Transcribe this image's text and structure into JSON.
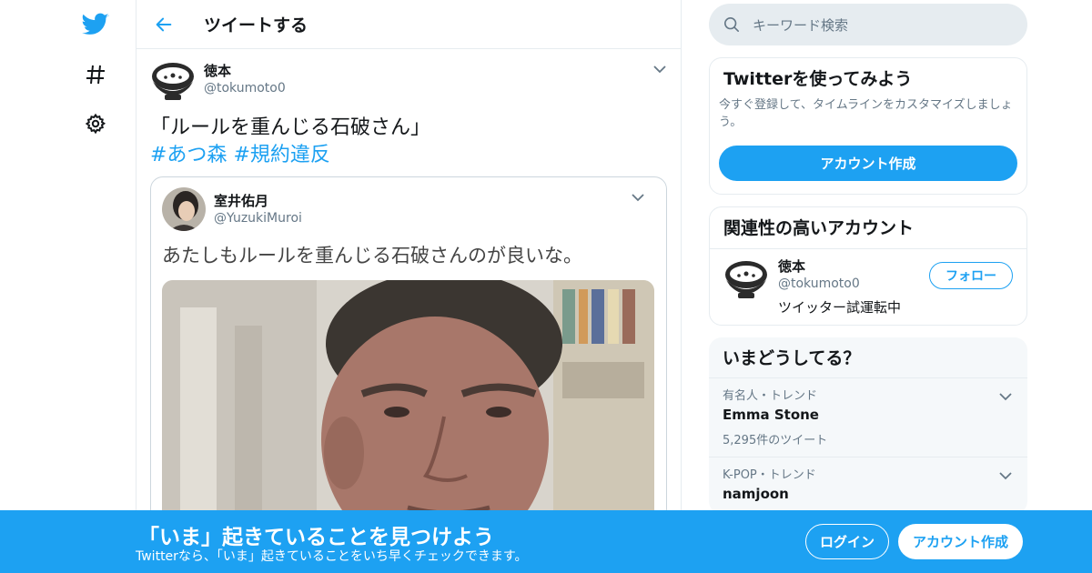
{
  "nav": {
    "icons": [
      "twitter-bird-icon",
      "hashtag-icon",
      "gear-icon"
    ]
  },
  "header": {
    "title": "ツイートする"
  },
  "tweet": {
    "author_name": "徳本",
    "author_handle": "@tokumoto0",
    "text": "「ルールを重んじる石破さん」",
    "hashtags": [
      "#あつ森",
      "#規約違反"
    ],
    "quote": {
      "author_name": "室井佑月",
      "author_handle": "@YuzukiMuroi",
      "text": "あたしもルールを重んじる石破さんのが良いな。"
    }
  },
  "search": {
    "placeholder": "キーワード検索"
  },
  "signup_card": {
    "title": "Twitterを使ってみよう",
    "description": "今すぐ登録して、タイムラインをカスタマイズしましょう。",
    "button": "アカウント作成"
  },
  "related": {
    "title": "関連性の高いアカウント",
    "account": {
      "name": "徳本",
      "handle": "@tokumoto0",
      "bio": "ツイッター試運転中",
      "follow_label": "フォロー"
    }
  },
  "trends": {
    "title": "いまどうしてる？",
    "items": [
      {
        "meta": "有名人・トレンド",
        "name": "Emma Stone",
        "count": "5,295件のツイート"
      },
      {
        "meta": "K-POP・トレンド",
        "name": "namjoon",
        "count": ""
      }
    ]
  },
  "banner": {
    "title": "「いま」起きていることを見つけよう",
    "subtitle": "Twitterなら、「いま」起きていることをいち早くチェックできます。",
    "login": "ログイン",
    "signup": "アカウント作成"
  },
  "colors": {
    "accent": "#1da1f2",
    "text_secondary": "#657786",
    "border": "#e6ecf0"
  }
}
